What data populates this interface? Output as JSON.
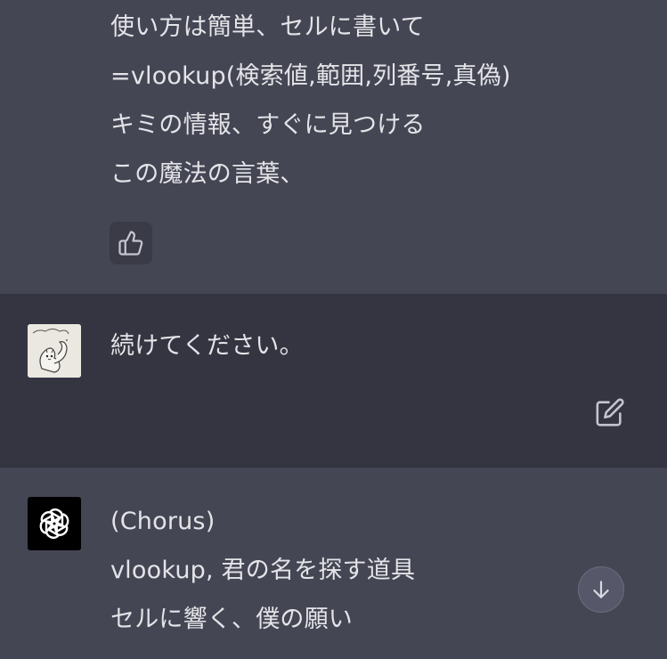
{
  "messages": [
    {
      "role": "assistant",
      "lines": [
        "使い方は簡単、セルに書いて",
        "=vlookup(検索値,範囲,列番号,真偽)",
        "キミの情報、すぐに見つける",
        "この魔法の言葉、"
      ],
      "icons": {
        "feedback": "thumbs-up-icon"
      }
    },
    {
      "role": "user",
      "text": "続けてください。",
      "icons": {
        "avatar": "squirrel-sketch-avatar",
        "edit": "edit-icon"
      }
    },
    {
      "role": "assistant",
      "lines": [
        "(Chorus)",
        "vlookup, 君の名を探す道具",
        "セルに響く、僕の願い"
      ],
      "icons": {
        "avatar": "openai-logo-icon",
        "scroll": "arrow-down-icon"
      }
    }
  ],
  "colors": {
    "assistant_bg": "#444654",
    "user_bg": "#343541",
    "text": "#ececf1",
    "icon": "#c5c5d2"
  }
}
